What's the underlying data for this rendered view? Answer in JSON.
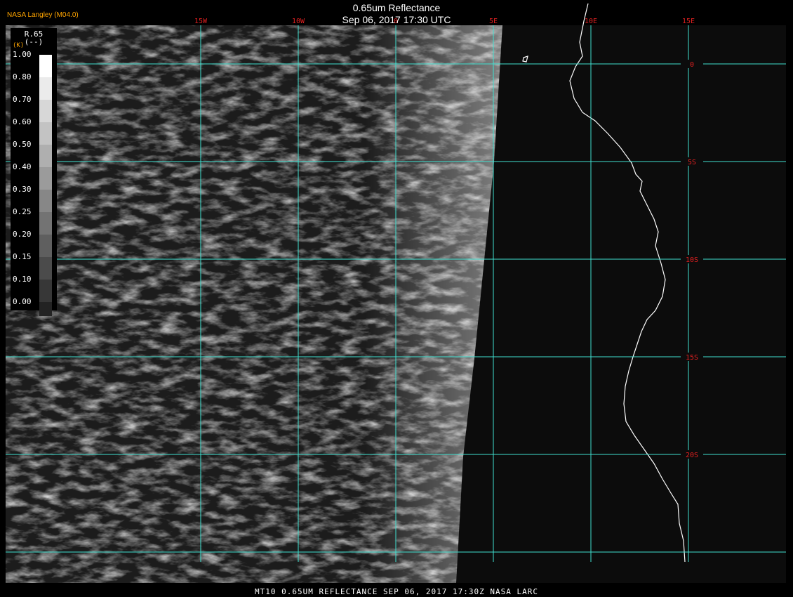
{
  "header": {
    "title": "0.65um Reflectance",
    "subtitle": "Sep 06, 2017 17:30 UTC",
    "brand": "NASA Langley (M04.0)"
  },
  "footer": {
    "text": "MT10  0.65UM REFLECTANCE   SEP 06, 2017 17:30Z   NASA LARC"
  },
  "legend": {
    "title_line1": "R.65",
    "title_line2": "(--)",
    "title_line3": "(K)",
    "ticks": [
      "1.00",
      "0.80",
      "0.70",
      "0.60",
      "0.50",
      "0.40",
      "0.30",
      "0.25",
      "0.20",
      "0.15",
      "0.10",
      "0.00"
    ],
    "swatch_colors": [
      "#ffffff",
      "#ebebeb",
      "#d7d7d7",
      "#c3c3c3",
      "#afafaf",
      "#9b9b9b",
      "#878787",
      "#737373",
      "#5f5f5f",
      "#4b4b4b",
      "#373737",
      "#232323"
    ]
  },
  "map": {
    "grid_color": "#40e0d0",
    "label_color": "#e02020",
    "longitudes": [
      {
        "label": "15W",
        "lon": -15
      },
      {
        "label": "10W",
        "lon": -10
      },
      {
        "label": "0",
        "lon": -5
      },
      {
        "label": "5E",
        "lon": 0
      },
      {
        "label": "10E",
        "lon": 5
      },
      {
        "label": "15E",
        "lon": 10
      }
    ],
    "latitudes": [
      {
        "label": "0",
        "lat": 0
      },
      {
        "label": "5S",
        "lat": -5
      },
      {
        "label": "10S",
        "lat": -10
      },
      {
        "label": "15S",
        "lat": -15
      },
      {
        "label": "20S",
        "lat": -20
      },
      {
        "label": "",
        "lat": -25
      }
    ]
  }
}
